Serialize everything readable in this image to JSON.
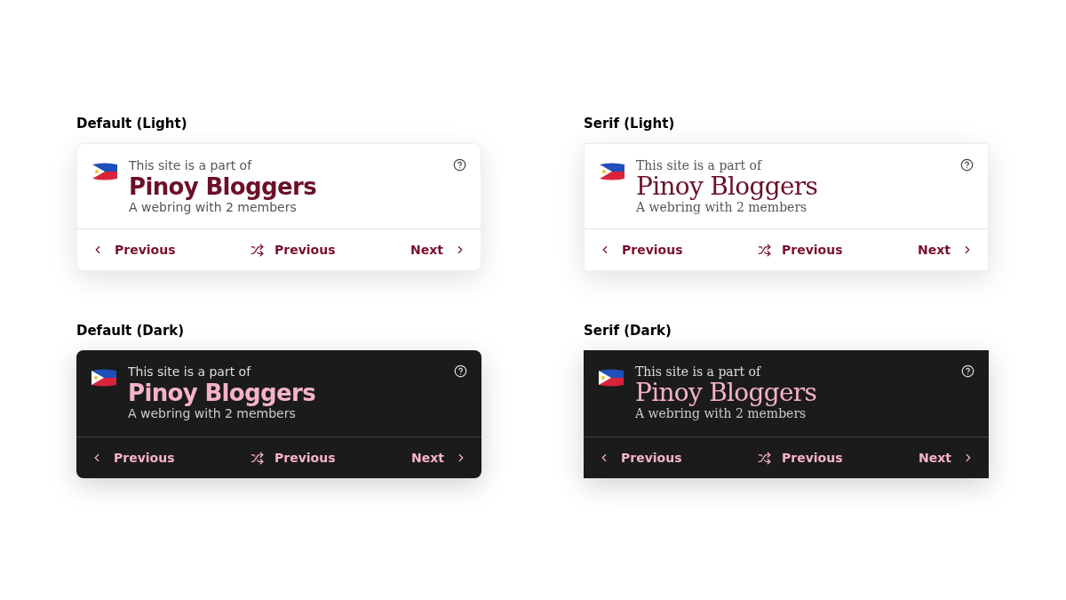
{
  "variants": [
    {
      "label": "Default (Light)",
      "dark": false,
      "kind": "sans",
      "intro": "This site is a part of",
      "name": "Pinoy Bloggers",
      "subtitle": "A webring with 2 members",
      "nav": [
        {
          "kind": "previous",
          "label": "Previous"
        },
        {
          "kind": "random",
          "label": "Previous"
        },
        {
          "kind": "next",
          "label": "Next"
        }
      ]
    },
    {
      "label": "Serif (Light)",
      "dark": false,
      "kind": "serif",
      "intro": "This site is a part of",
      "name": "Pinoy Bloggers",
      "subtitle": "A webring with 2 members",
      "nav": [
        {
          "kind": "previous",
          "label": "Previous"
        },
        {
          "kind": "random",
          "label": "Previous"
        },
        {
          "kind": "next",
          "label": "Next"
        }
      ]
    },
    {
      "label": "Default (Dark)",
      "dark": true,
      "kind": "sans",
      "intro": "This site is a part of",
      "name": "Pinoy Bloggers",
      "subtitle": "A webring with 2 members",
      "nav": [
        {
          "kind": "previous",
          "label": "Previous"
        },
        {
          "kind": "random",
          "label": "Previous"
        },
        {
          "kind": "next",
          "label": "Next"
        }
      ]
    },
    {
      "label": "Serif (Dark)",
      "dark": true,
      "kind": "serif",
      "intro": "This site is a part of",
      "name": "Pinoy Bloggers",
      "subtitle": "A webring with 2 members",
      "nav": [
        {
          "kind": "previous",
          "label": "Previous"
        },
        {
          "kind": "random",
          "label": "Previous"
        },
        {
          "kind": "next",
          "label": "Next"
        }
      ]
    }
  ]
}
